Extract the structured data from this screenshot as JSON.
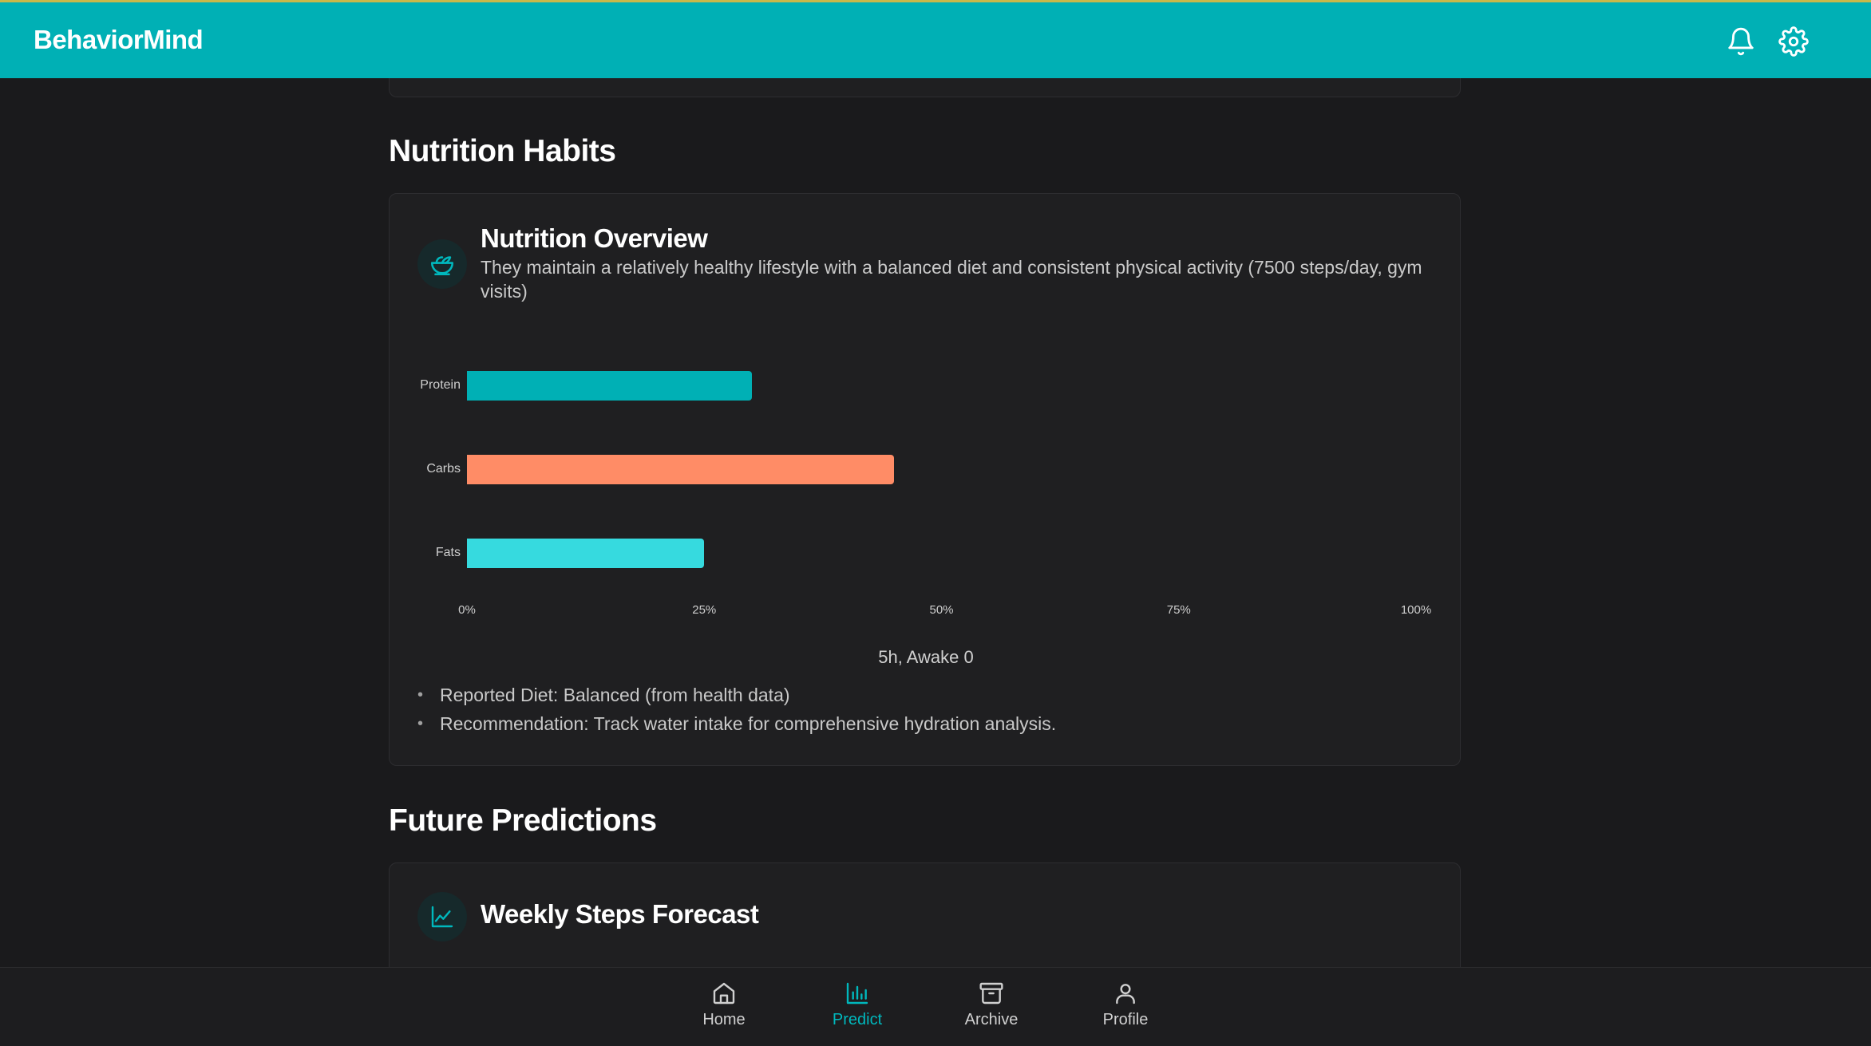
{
  "app": {
    "brand": "BehaviorMind"
  },
  "header_icons": [
    "bell-icon",
    "gear-icon"
  ],
  "sections": {
    "nutrition": {
      "title": "Nutrition Habits",
      "card": {
        "icon": "salad-bowl-icon",
        "title": "Nutrition Overview",
        "description": "They maintain a relatively healthy lifestyle with a balanced diet and consistent physical activity (7500 steps/day, gym visits)",
        "caption": "5h, Awake 0",
        "bullets": [
          "Reported Diet: Balanced (from health data)",
          "Recommendation: Track water intake for comprehensive hydration analysis."
        ]
      }
    },
    "predictions": {
      "title": "Future Predictions",
      "card": {
        "icon": "trend-chart-icon",
        "title": "Weekly Steps Forecast"
      }
    }
  },
  "chart_data": {
    "type": "bar",
    "orientation": "horizontal",
    "categories": [
      "Protein",
      "Carbs",
      "Fats"
    ],
    "values": [
      30,
      45,
      25
    ],
    "colors": [
      "#00b0b5",
      "#ff8c66",
      "#36dadf"
    ],
    "xlim": [
      0,
      100
    ],
    "x_ticks": [
      "0%",
      "25%",
      "50%",
      "75%",
      "100%"
    ]
  },
  "nav": {
    "items": [
      {
        "label": "Home",
        "icon": "home-icon",
        "active": false
      },
      {
        "label": "Predict",
        "icon": "bar-chart-icon",
        "active": true
      },
      {
        "label": "Archive",
        "icon": "archive-box-icon",
        "active": false
      },
      {
        "label": "Profile",
        "icon": "user-icon",
        "active": false
      }
    ]
  },
  "colors": {
    "accent": "#00b0b5",
    "background": "#1a1a1c",
    "card": "#1f1f21"
  }
}
